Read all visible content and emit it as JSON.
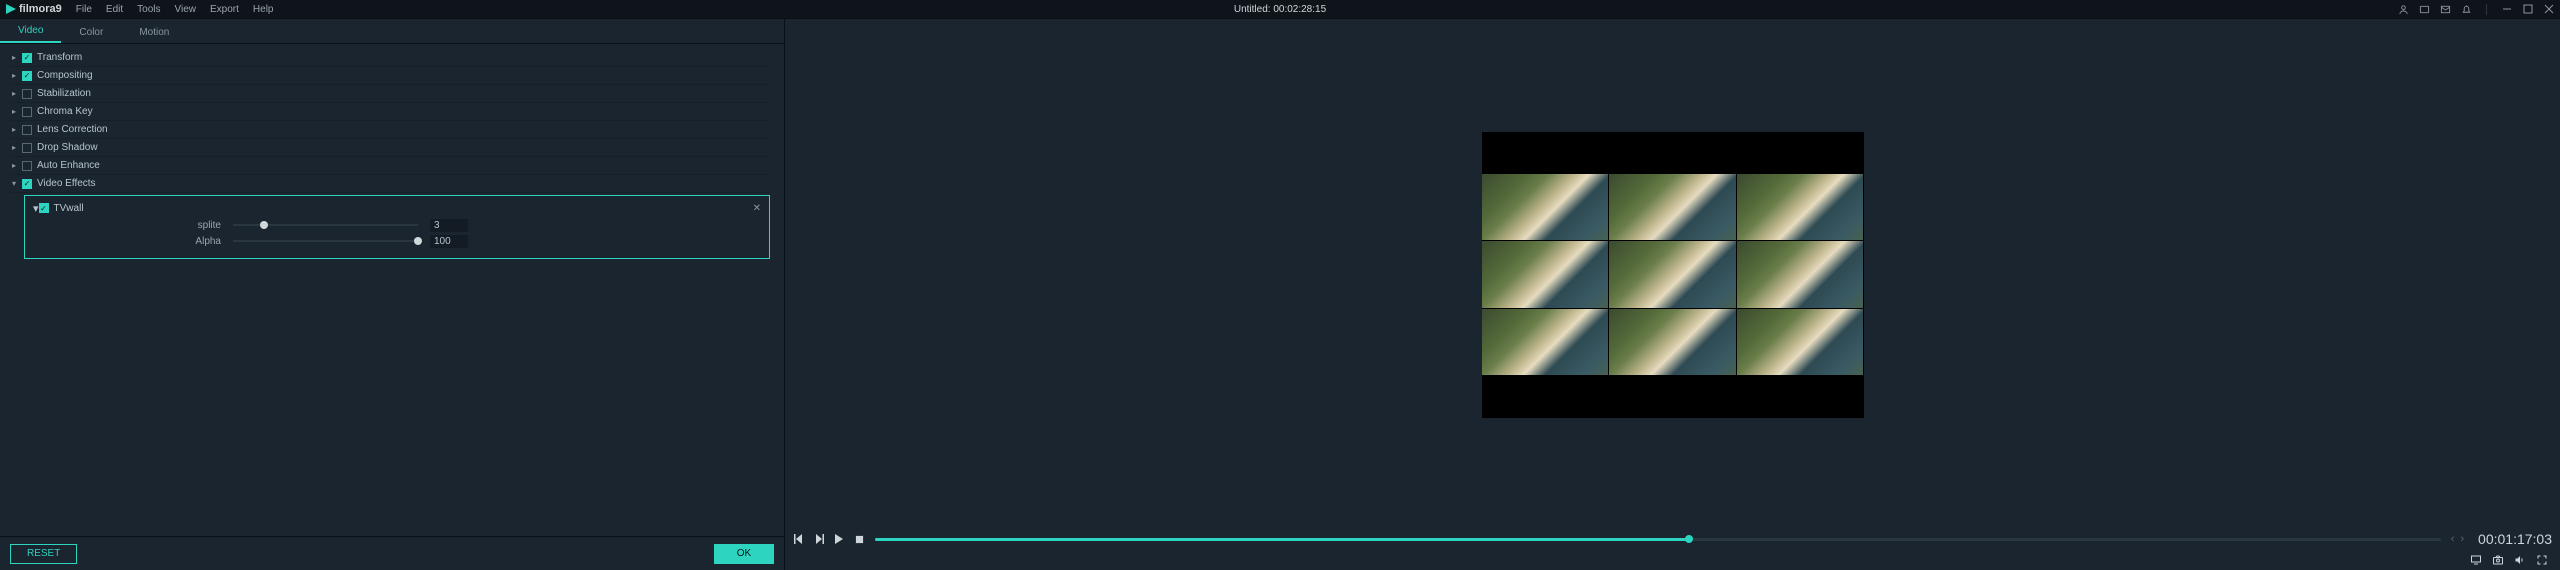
{
  "app": {
    "name": "filmora9"
  },
  "menu": [
    "File",
    "Edit",
    "Tools",
    "View",
    "Export",
    "Help"
  ],
  "document": {
    "title": "Untitled:",
    "duration": "00:02:28:15"
  },
  "tabs": [
    {
      "label": "Video",
      "active": true
    },
    {
      "label": "Color",
      "active": false
    },
    {
      "label": "Motion",
      "active": false
    }
  ],
  "sections": [
    {
      "id": "transform",
      "label": "Transform",
      "checked": true,
      "expanded": false
    },
    {
      "id": "compositing",
      "label": "Compositing",
      "checked": true,
      "expanded": false
    },
    {
      "id": "stabilization",
      "label": "Stabilization",
      "checked": false,
      "expanded": false
    },
    {
      "id": "chromakey",
      "label": "Chroma Key",
      "checked": false,
      "expanded": false
    },
    {
      "id": "lenscorrection",
      "label": "Lens Correction",
      "checked": false,
      "expanded": false
    },
    {
      "id": "dropshadow",
      "label": "Drop Shadow",
      "checked": false,
      "expanded": false
    },
    {
      "id": "autoenhance",
      "label": "Auto Enhance",
      "checked": false,
      "expanded": false
    },
    {
      "id": "videoeffects",
      "label": "Video Effects",
      "checked": true,
      "expanded": true
    }
  ],
  "effect": {
    "name": "TVwall",
    "checked": true,
    "params": [
      {
        "label": "splite",
        "value": "3",
        "percent": 17
      },
      {
        "label": "Alpha",
        "value": "100",
        "percent": 100
      }
    ]
  },
  "buttons": {
    "reset": "RESET",
    "ok": "OK"
  },
  "preview": {
    "timecode": "00:01:17:03",
    "progress_percent": 52
  }
}
